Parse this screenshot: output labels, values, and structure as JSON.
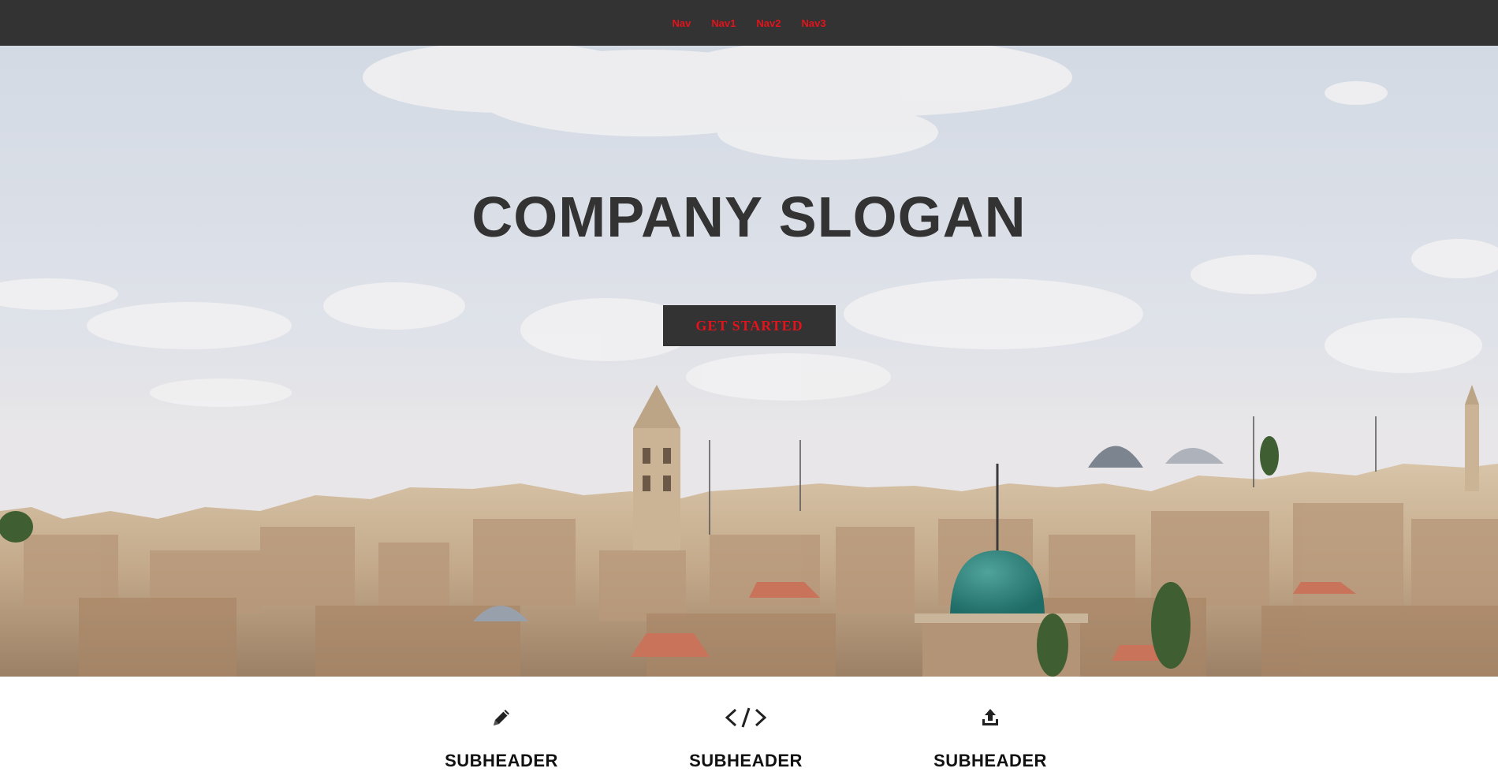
{
  "nav": {
    "items": [
      "Nav",
      "Nav1",
      "Nav2",
      "Nav3"
    ]
  },
  "hero": {
    "slogan": "COMPANY SLOGAN",
    "cta_label": "GET STARTED"
  },
  "features": [
    {
      "icon": "pencil-icon",
      "label": "SUBHEADER"
    },
    {
      "icon": "code-icon",
      "label": "SUBHEADER"
    },
    {
      "icon": "upload-icon",
      "label": "SUBHEADER"
    }
  ],
  "colors": {
    "nav_bg": "#333333",
    "accent": "#e3131b",
    "slogan": "#333333",
    "button_bg": "#333333"
  }
}
